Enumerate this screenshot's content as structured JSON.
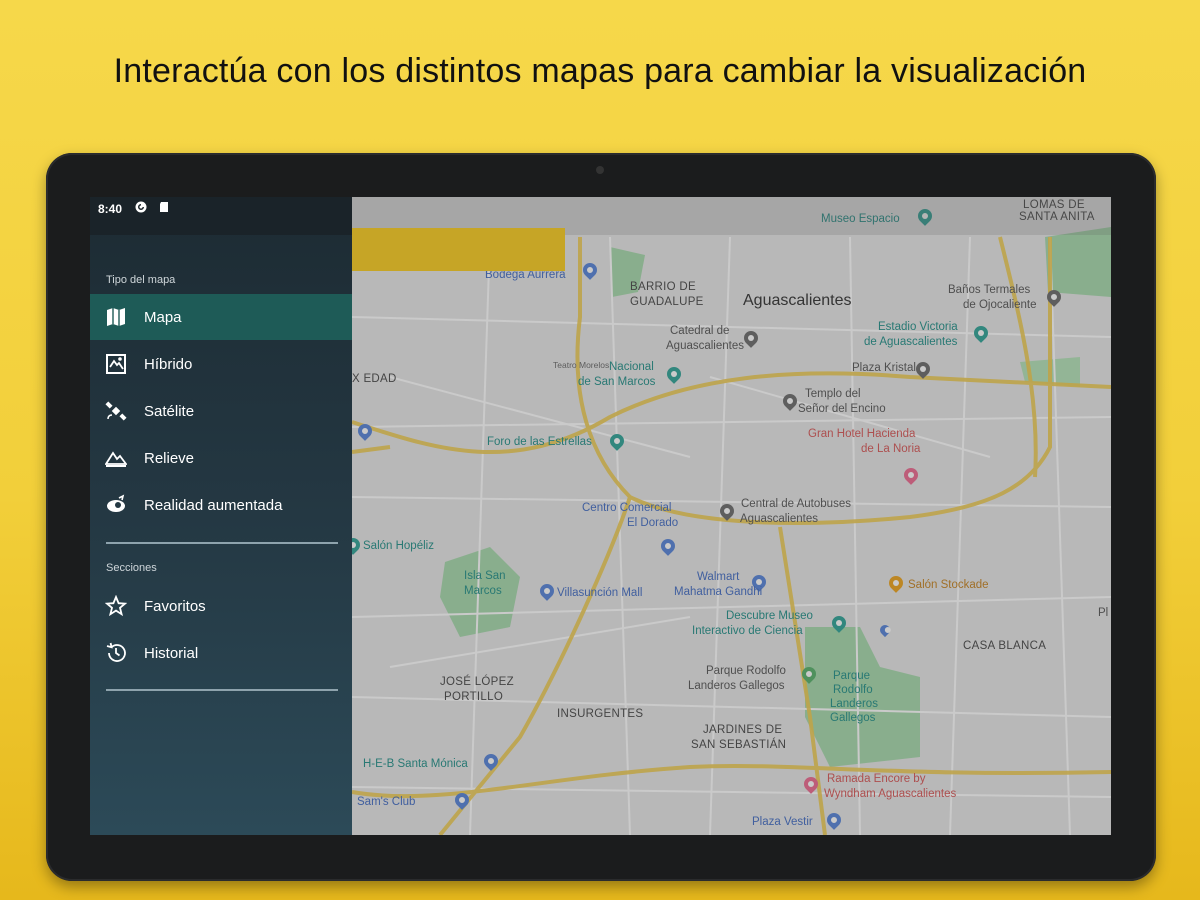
{
  "headline": "Interactúa con los distintos mapas para cambiar la visualización",
  "status": {
    "time": "8:40"
  },
  "drawer": {
    "map_type_title": "Tipo del mapa",
    "map_types": [
      {
        "label": "Mapa",
        "icon": "map-icon",
        "active": true
      },
      {
        "label": "Híbrido",
        "icon": "hybrid-map-icon",
        "active": false
      },
      {
        "label": "Satélite",
        "icon": "satellite-icon",
        "active": false
      },
      {
        "label": "Relieve",
        "icon": "terrain-icon",
        "active": false
      },
      {
        "label": "Realidad aumentada",
        "icon": "augmented-reality-icon",
        "active": false
      }
    ],
    "sections_title": "Secciones",
    "sections": [
      {
        "label": "Favoritos",
        "icon": "star-icon"
      },
      {
        "label": "Historial",
        "icon": "history-icon"
      }
    ]
  },
  "map": {
    "city": "Aguascalientes",
    "districts": [
      "BARRIO DE",
      "GUADALUPE",
      "JOSÉ LÓPEZ",
      "PORTILLO",
      "INSURGENTES",
      "CASA BLANCA",
      "LOMAS DE",
      "SANTA ANITA",
      "JARDINES DE",
      "SAN SEBASTIÁN",
      "X EDAD"
    ],
    "places": [
      "Museo Espacio",
      "Bodega Aurrera",
      "Baños Termales",
      "de Ojocaliente",
      "Catedral de",
      "Aguascalientes",
      "Estadio Victoria",
      "de Aguascalientes",
      "Teatro Morelos",
      "Plaza Kristal",
      "Templo del",
      "Señor del Encino",
      "Gran Hotel Hacienda",
      "de La Noria",
      "Foro de las Estrellas",
      "Centro Comercial",
      "El Dorado",
      "Central de Autobuses",
      "Aguascalientes",
      "Salón Hopéliz",
      "Isla San",
      "Marcos",
      "Villasunción Mall",
      "Walmart",
      "Mahatma Gandhi",
      "Salón Stockade",
      "Descubre Museo",
      "Interactivo de Ciencia",
      "Parque Rodolfo",
      "Landeros Gallegos",
      "Parque",
      "Rodolfo",
      "Landeros",
      "Gallegos",
      "H-E-B Santa Mónica",
      "Sam's Club",
      "Ramada Encore by",
      "Wyndham Aguascalientes",
      "Plaza Vestir",
      "Nacional",
      "de San Marcos",
      "Pl"
    ]
  },
  "colors": {
    "drawer_active": "#1e5b57",
    "background": "#f4d33f"
  }
}
